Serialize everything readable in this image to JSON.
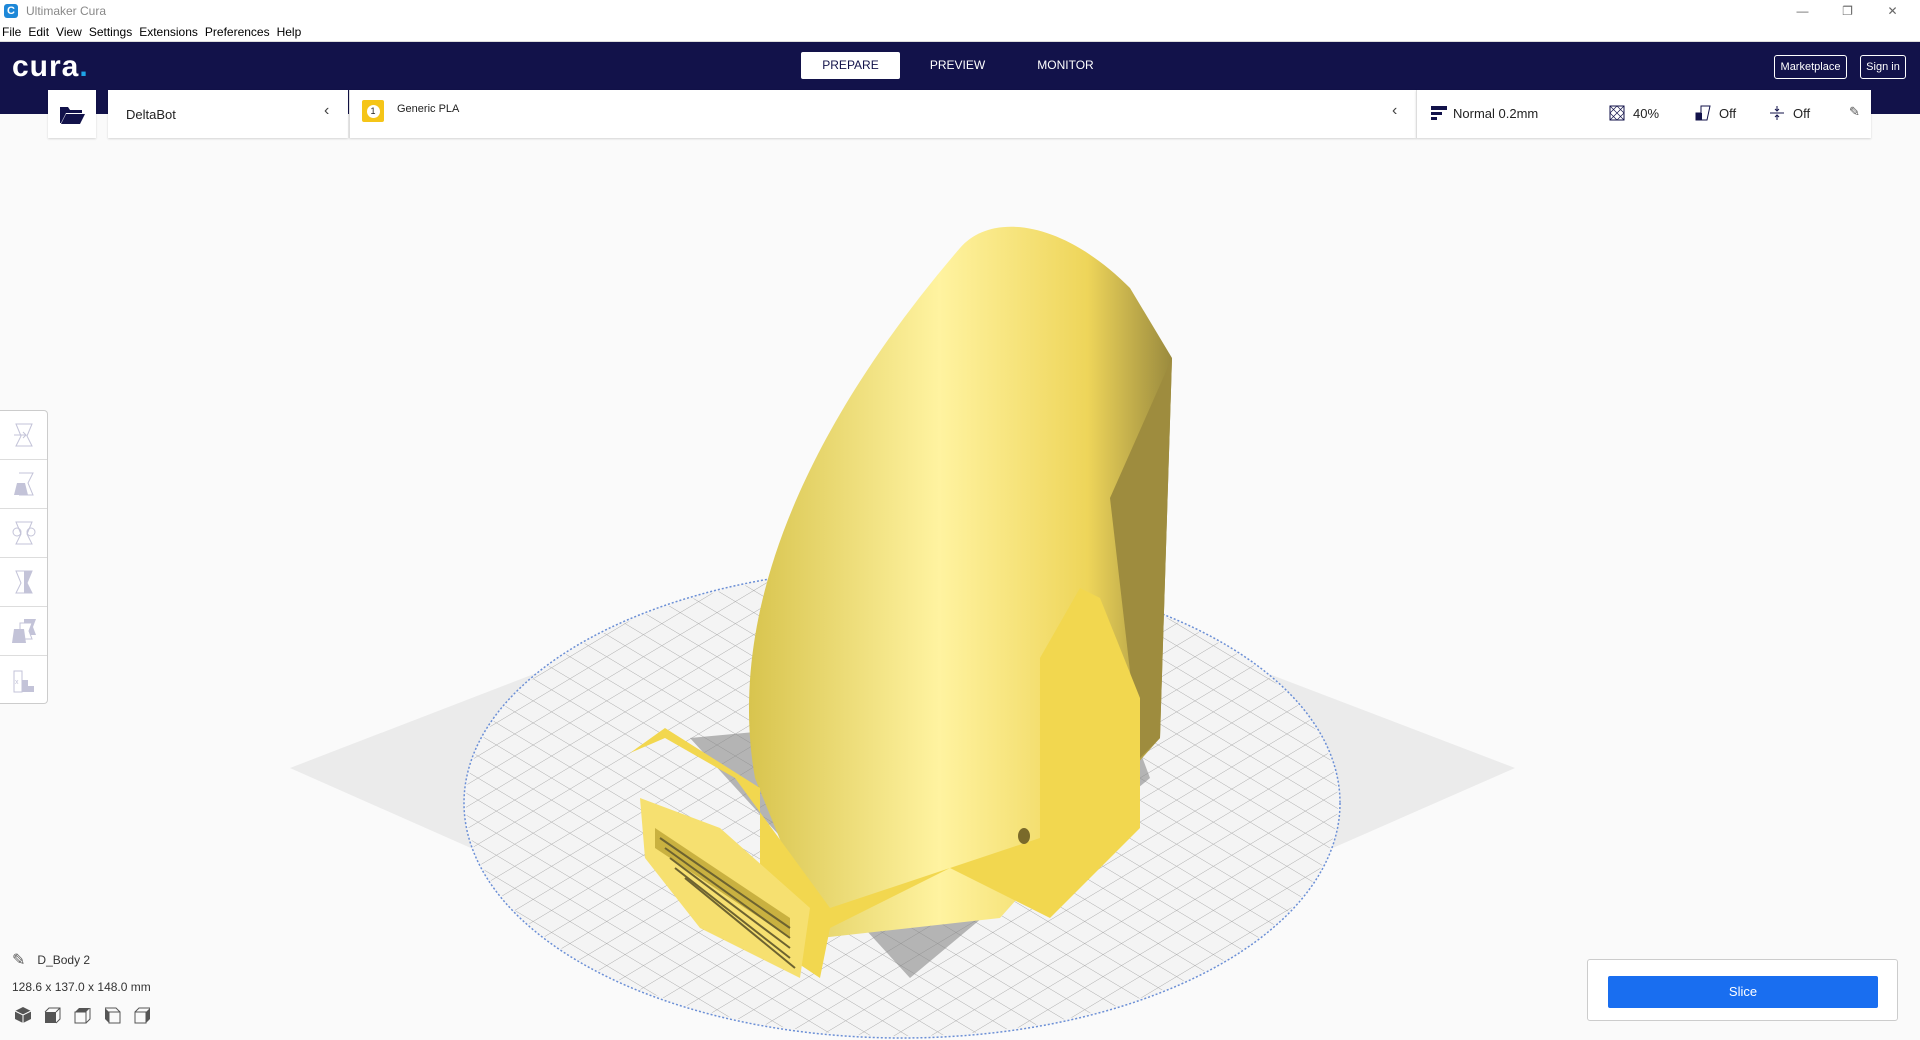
{
  "window": {
    "title": "Ultimaker Cura",
    "app_icon": "C"
  },
  "menu": [
    "File",
    "Edit",
    "View",
    "Settings",
    "Extensions",
    "Preferences",
    "Help"
  ],
  "nav": {
    "logo": "cura",
    "tabs": [
      "PREPARE",
      "PREVIEW",
      "MONITOR"
    ],
    "active_tab": "PREPARE",
    "marketplace": "Marketplace",
    "sign_in": "Sign in"
  },
  "stage": {
    "printer": "DeltaBot",
    "material_badge": "1",
    "material": "Generic PLA",
    "profile": "Normal 0.2mm",
    "infill": "40%",
    "support": "Off",
    "adhesion": "Off"
  },
  "object": {
    "name": "D_Body 2",
    "dimensions": "128.6 x 137.0 x 148.0 mm"
  },
  "slice": {
    "label": "Slice"
  },
  "colors": {
    "nav": "#12124a",
    "accent": "#196ef0",
    "model": "#f5e06a"
  }
}
